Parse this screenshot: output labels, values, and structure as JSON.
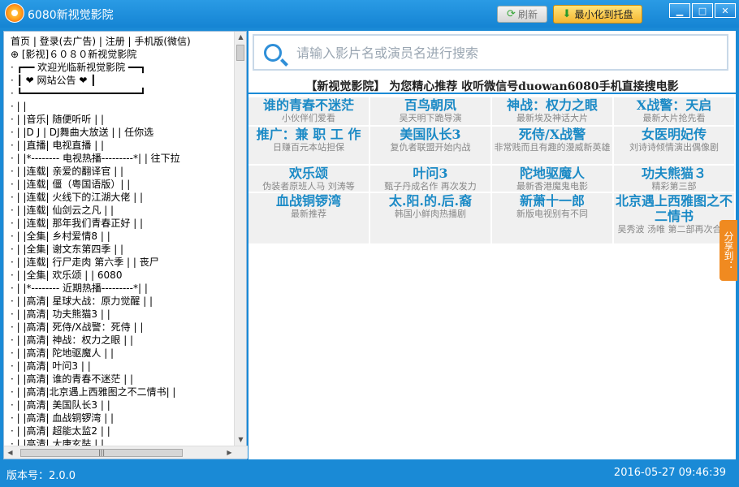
{
  "window": {
    "title": "6080新视觉影院",
    "refresh_label": "刷新",
    "minimize_tray_label": "最小化到托盘"
  },
  "tree_lines": [
    "首页 | 登录(去广告) | 注册 | 手机版(微信)",
    "⊕ [影视]６０８０新视觉影院",
    "  ·  ┏━━ 欢迎光临新视觉影院 ━━┓",
    "  ·  ┃ ❤      网站公告      ❤ ┃",
    "  ·  ┗━━━━━━━━━━━━━━━━━━━━┛",
    "  ·  | |",
    "  ·  | |音乐|   随便听听    |  |",
    "  ·  | |D J |   DJ舞曲大放送 |  | 任你选",
    "  ·  | |直播|   电视直播     |  |",
    "  ·  | |*-------- 电视热播---------*| | 往下拉",
    "  ·  | |连载|   亲爱的翻译官  |  |",
    "  ·  | |连载|   僵（粤国语版）|  |",
    "  ·  | |连载|  火线下的江湖大佬 | |",
    "  ·  | |连载|    仙剑云之凡   |  |",
    "  ·  | |连载| 那年我们青春正好 | |",
    "  ·  | |全集|   乡村爱情8    |  |",
    "  ·  | |全集|   谢文东第四季  |  |",
    "  ·  | |连载|  行尸走肉 第六季 |  | 丧尸",
    "  ·  | |全集|    欢乐颂      |  | 6080",
    "  ·  | |*-------- 近期热播---------*| |",
    "  ·  | |高清| 星球大战：原力觉醒 | |",
    "  ·  | |高清|   功夫熊猫3    |  |",
    "  ·  | |高清| 死侍/X战警：死侍 | |",
    "  ·  | |高清|  神战：权力之眼  | |",
    "  ·  | |高清|   陀地驱魔人    | |",
    "  ·  | |高清|    叶问3       | |",
    "  ·  | |高清|  谁的青春不迷茫  | |",
    "  ·  | |高清|北京遇上西雅图之不二情书| |",
    "  ·  | |高清|   美国队长3    | |",
    "  ·  | |高清|   血战铜锣湾    | |",
    "  ·  | |高清|   超能太监2    | |",
    "  ·  | |高清|   大唐玄奘     | |"
  ],
  "search": {
    "placeholder": "请输入影片名或演员名进行搜索"
  },
  "banner": "【新视觉影院】 为您精心推荐 收听微信号duowan6080手机直接搜电影",
  "grid_cells": [
    {
      "title": "谁的青春不迷茫",
      "subtitle": "小伙伴们爱看"
    },
    {
      "title": "百鸟朝凤",
      "subtitle": "吴天明下跪导演"
    },
    {
      "title": "神战：权力之眼",
      "subtitle": "最新埃及神话大片"
    },
    {
      "title": "X战警：天启",
      "subtitle": "最新大片抢先看"
    },
    {
      "title": "推广：兼 职 工 作",
      "subtitle": "日赚百元本站担保"
    },
    {
      "title": "美国队长3",
      "subtitle": "复仇者联盟开始内战"
    },
    {
      "title": "死侍/X战警",
      "subtitle": "非常贱而且有趣的漫威新英雄"
    },
    {
      "title": "女医明妃传",
      "subtitle": "刘诗诗倾情演出偶像剧"
    },
    {
      "title": "欢乐颂",
      "subtitle": "伪装者原班人马 刘涛等"
    },
    {
      "title": "叶问3",
      "subtitle": "甄子丹成名作 再次发力"
    },
    {
      "title": "陀地驱魔人",
      "subtitle": "最新香港魔鬼电影"
    },
    {
      "title": "功夫熊猫３",
      "subtitle": "精彩第三部"
    },
    {
      "title": "血战铜锣湾",
      "subtitle": "最新推荐"
    },
    {
      "title": "太.阳.的.后.裔",
      "subtitle": "韩国小鲜肉热播剧"
    },
    {
      "title": "新萧十一郎",
      "subtitle": "新版电视别有不同"
    },
    {
      "title": "北京遇上西雅图之不二情书",
      "subtitle": "吴秀波 汤唯 第二部再次合作"
    }
  ],
  "share_label": "分享到：",
  "status": {
    "version": "版本号：2.0.0",
    "datetime": "2016-05-27 09:46:39"
  }
}
